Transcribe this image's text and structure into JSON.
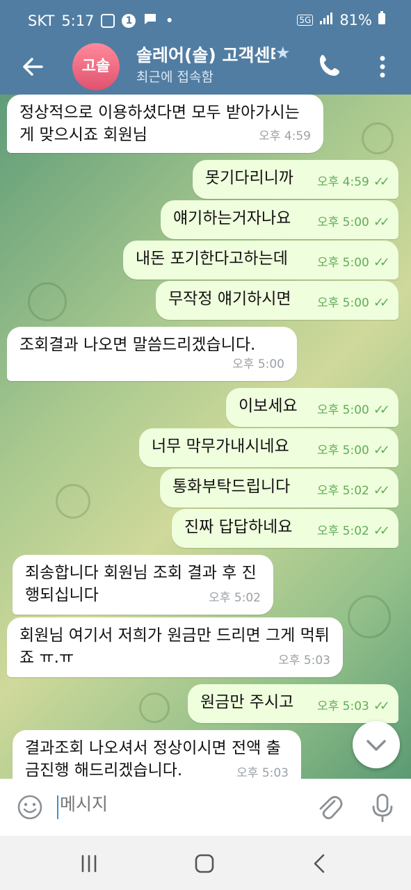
{
  "status": {
    "carrier": "SKT",
    "time": "5:17",
    "notif_count": "1",
    "network": "5G",
    "battery": "81%"
  },
  "header": {
    "title": "솔레어(솔) 고객센터",
    "subtitle": "최근에 접속함",
    "avatar_text": "고솔"
  },
  "messages": [
    {
      "dir": "in",
      "text": "정상적으로 이용하셨다면 모두 받아가시는게 맞으시죠 회원님",
      "time": "오후 4:59"
    },
    {
      "dir": "out",
      "text": "못기다리니까",
      "time": "오후 4:59"
    },
    {
      "dir": "out",
      "text": "얘기하는거자나요",
      "time": "오후 5:00"
    },
    {
      "dir": "out",
      "text": "내돈 포기한다고하는데",
      "time": "오후 5:00"
    },
    {
      "dir": "out",
      "text": "무작정 얘기하시면",
      "time": "오후 5:00"
    },
    {
      "dir": "in",
      "text": "조회결과 나오면 말씀드리겠습니다.",
      "time": "오후 5:00"
    },
    {
      "dir": "out",
      "text": "이보세요",
      "time": "오후 5:00"
    },
    {
      "dir": "out",
      "text": "너무 막무가내시네요",
      "time": "오후 5:00"
    },
    {
      "dir": "out",
      "text": "통화부탁드립니다",
      "time": "오후 5:02"
    },
    {
      "dir": "out",
      "text": "진짜 답답하네요",
      "time": "오후 5:02"
    },
    {
      "dir": "in",
      "text": "죄송합니다 회원님 조회 결과 후 진행되십니다",
      "time": "오후 5:02"
    },
    {
      "dir": "in",
      "text": "회원님 여기서 저희가 원금만 드리면 그게 먹튀죠 ㅠ.ㅠ",
      "time": "오후 5:03"
    },
    {
      "dir": "out",
      "text": "원금만 주시고",
      "time": "오후 5:03"
    },
    {
      "dir": "in",
      "text": "결과조회 나오셔서 정상이시면 전액 출금진행 해드리겠습니다.",
      "time": "오후 5:03"
    }
  ],
  "composer": {
    "placeholder": "메시지"
  },
  "colors": {
    "header": "#517da2",
    "outgoing_bubble": "#effedd",
    "incoming_bubble": "#ffffff",
    "tick": "#5fad56"
  },
  "icons": [
    "back-arrow-icon",
    "star-icon",
    "phone-icon",
    "more-vert-icon",
    "chevron-down-icon",
    "emoji-icon",
    "paperclip-icon",
    "mic-icon",
    "recents-nav-icon",
    "home-nav-icon",
    "back-nav-icon"
  ]
}
